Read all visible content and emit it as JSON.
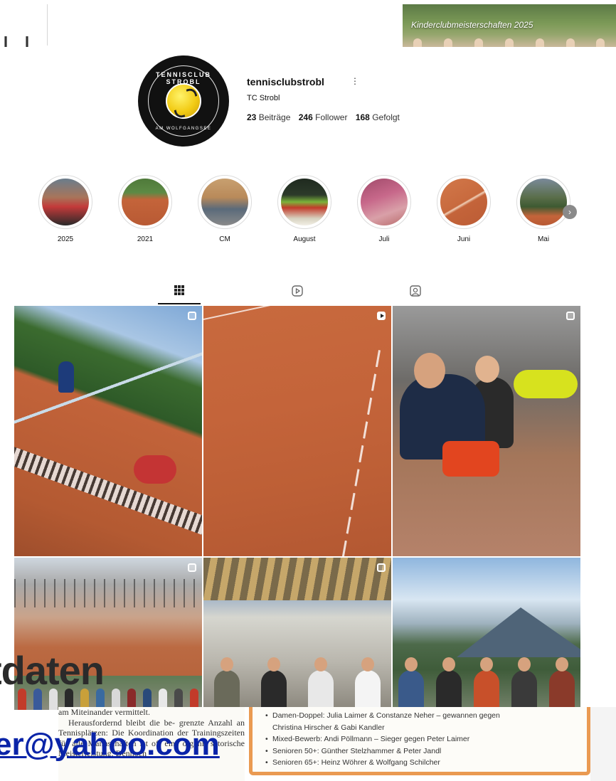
{
  "top_left_fragment": "l l",
  "top_banner": {
    "caption": "Kinderclubmeisterschaften 2025"
  },
  "profile": {
    "username": "tennisclubstrobl",
    "display_name": "TC Strobl",
    "more_icon": "⋮",
    "stats": {
      "posts_count": "23",
      "posts_label": "Beiträge",
      "followers_count": "246",
      "followers_label": "Follower",
      "following_count": "168",
      "following_label": "Gefolgt"
    },
    "logo": {
      "top_text": "TENNISCLUB STROBL",
      "bottom_text": "AM WOLFGANGSEE"
    }
  },
  "highlights": [
    {
      "label": "2025"
    },
    {
      "label": "2021"
    },
    {
      "label": "CM"
    },
    {
      "label": "August"
    },
    {
      "label": "Juli"
    },
    {
      "label": "Juni"
    },
    {
      "label": "Mai"
    }
  ],
  "highlights_next_icon": "›",
  "tabs": [
    {
      "name": "posts-grid-icon",
      "active": true
    },
    {
      "name": "reels-icon",
      "active": false
    },
    {
      "name": "tagged-icon",
      "active": false
    }
  ],
  "overlay": {
    "big_text": "tdaten",
    "email": "er@yahoo.com"
  },
  "document_left": {
    "paragraphs": [
      "am Miteinander vermittelt.",
      "Herausfordernd bleibt die be- grenzte Anzahl an Tennisplätzen: Die Koordination der Trainingszeiten für alle Mannschaften ist oft eine organi- satorische Meisterleistung. Dennoch"
    ]
  },
  "document_right": {
    "items": [
      "Damen-Doppel: Julia Laimer & Constanze Neher – gewannen gegen",
      "Christina Hirscher & Gabi Kandler",
      "Mixed-Bewerb: Andi Pöllmann – Sieger gegen Peter Laimer",
      "Senioren 50+: Günther Stelzhammer & Peter Jandl",
      "Senioren 65+: Heinz Wöhrer & Wolfgang Schilcher"
    ]
  },
  "colors": {
    "accent_border": "#ea9a52",
    "link": "#0a24a8",
    "clay": "#c4643a"
  }
}
